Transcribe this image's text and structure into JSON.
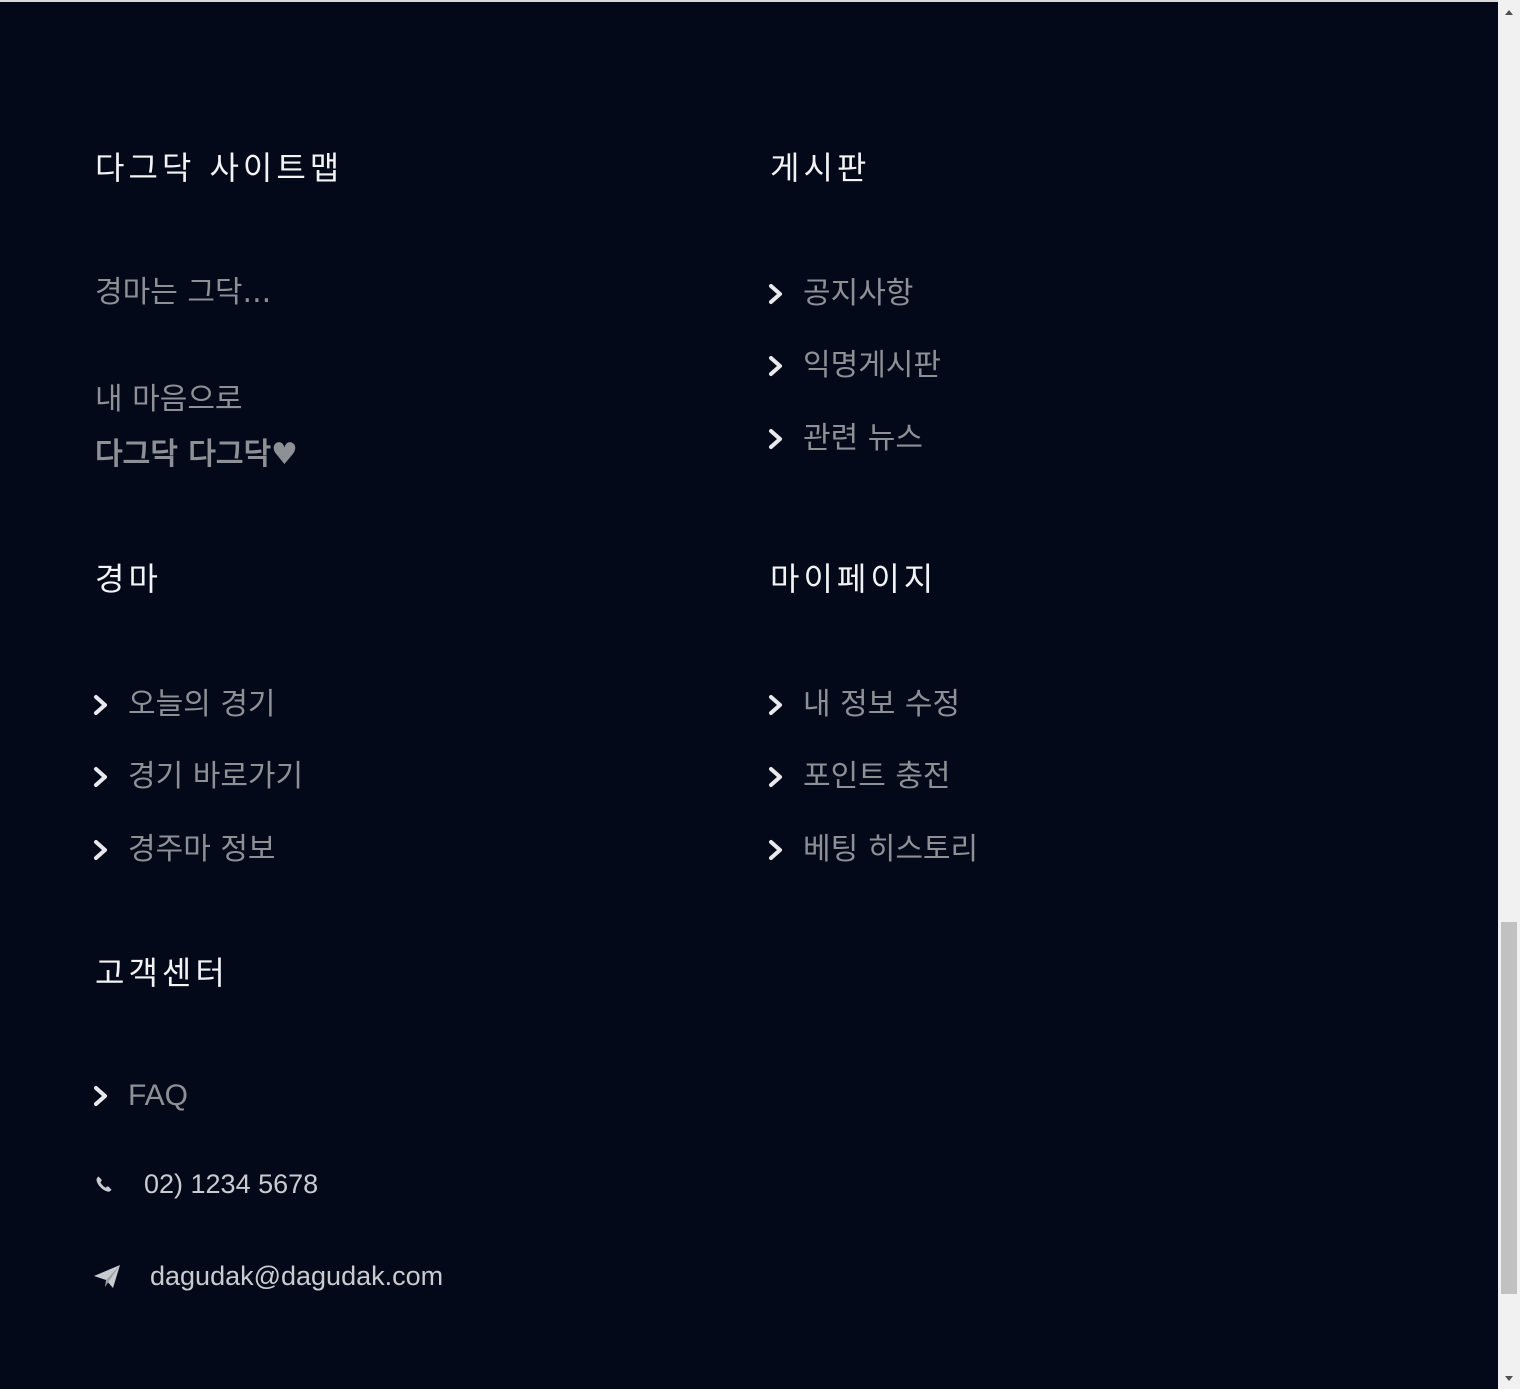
{
  "sitemap": {
    "title": "다그닥 사이트맵",
    "tagline": "경마는 그닥...",
    "message_line1": "내 마음으로",
    "message_line2": "다그닥 다그닥♥"
  },
  "board": {
    "title": "게시판",
    "items": [
      {
        "label": "공지사항"
      },
      {
        "label": "익명게시판"
      },
      {
        "label": "관련 뉴스"
      }
    ]
  },
  "horse_racing": {
    "title": "경마",
    "items": [
      {
        "label": "오늘의 경기"
      },
      {
        "label": "경기 바로가기"
      },
      {
        "label": "경주마 정보"
      }
    ]
  },
  "mypage": {
    "title": "마이페이지",
    "items": [
      {
        "label": "내 정보 수정"
      },
      {
        "label": "포인트 충전"
      },
      {
        "label": "베팅 히스토리"
      }
    ]
  },
  "support": {
    "title": "고객센터",
    "faq": "FAQ",
    "phone": "02) 1234 5678",
    "email": "dagudak@dagudak.com",
    "icons": {
      "phone": "phone-icon",
      "email": "paper-plane-icon",
      "link": "chevron-right-icon"
    }
  },
  "colors": {
    "background": "#030919",
    "heading": "#f3f3f5",
    "muted": "#8e9096"
  }
}
